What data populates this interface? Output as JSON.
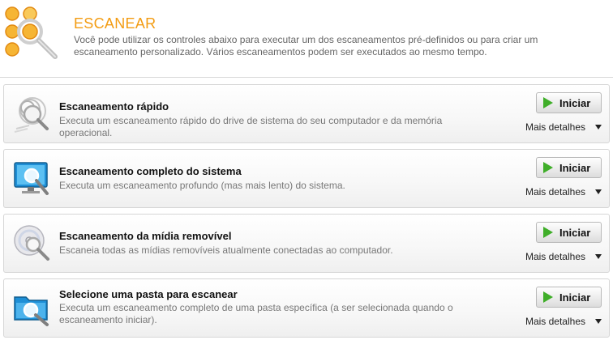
{
  "header": {
    "title": "ESCANEAR",
    "description": "Você pode utilizar os controles abaixo para executar um dos escaneamentos pré-definidos ou para criar um escaneamento personalizado. Vários escaneamentos podem ser executados ao mesmo tempo.",
    "icon": "scan-magnifier-icon",
    "accent_color": "#f39c12"
  },
  "scans": [
    {
      "title": "Escaneamento rápido",
      "description": "Executa um escaneamento rápido do drive de sistema do seu computador e da memória operacional.",
      "icon": "quick-scan-icon",
      "start_label": "Iniciar",
      "details_label": "Mais detalhes"
    },
    {
      "title": "Escaneamento completo do sistema",
      "description": "Executa um escaneamento profundo (mas mais lento) do sistema.",
      "icon": "monitor-scan-icon",
      "start_label": "Iniciar",
      "details_label": "Mais detalhes"
    },
    {
      "title": "Escaneamento da mídia removível",
      "description": "Escaneia todas as mídias removíveis atualmente conectadas ao computador.",
      "icon": "disc-scan-icon",
      "start_label": "Iniciar",
      "details_label": "Mais detalhes"
    },
    {
      "title": "Selecione uma pasta para escanear",
      "description": "Executa um escaneamento completo de uma pasta específica (a ser selecionada quando o escaneamento iniciar).",
      "icon": "folder-scan-icon",
      "start_label": "Iniciar",
      "details_label": "Mais detalhes"
    }
  ],
  "colors": {
    "play_green": "#3fae29",
    "monitor_blue": "#1e8fd6"
  }
}
